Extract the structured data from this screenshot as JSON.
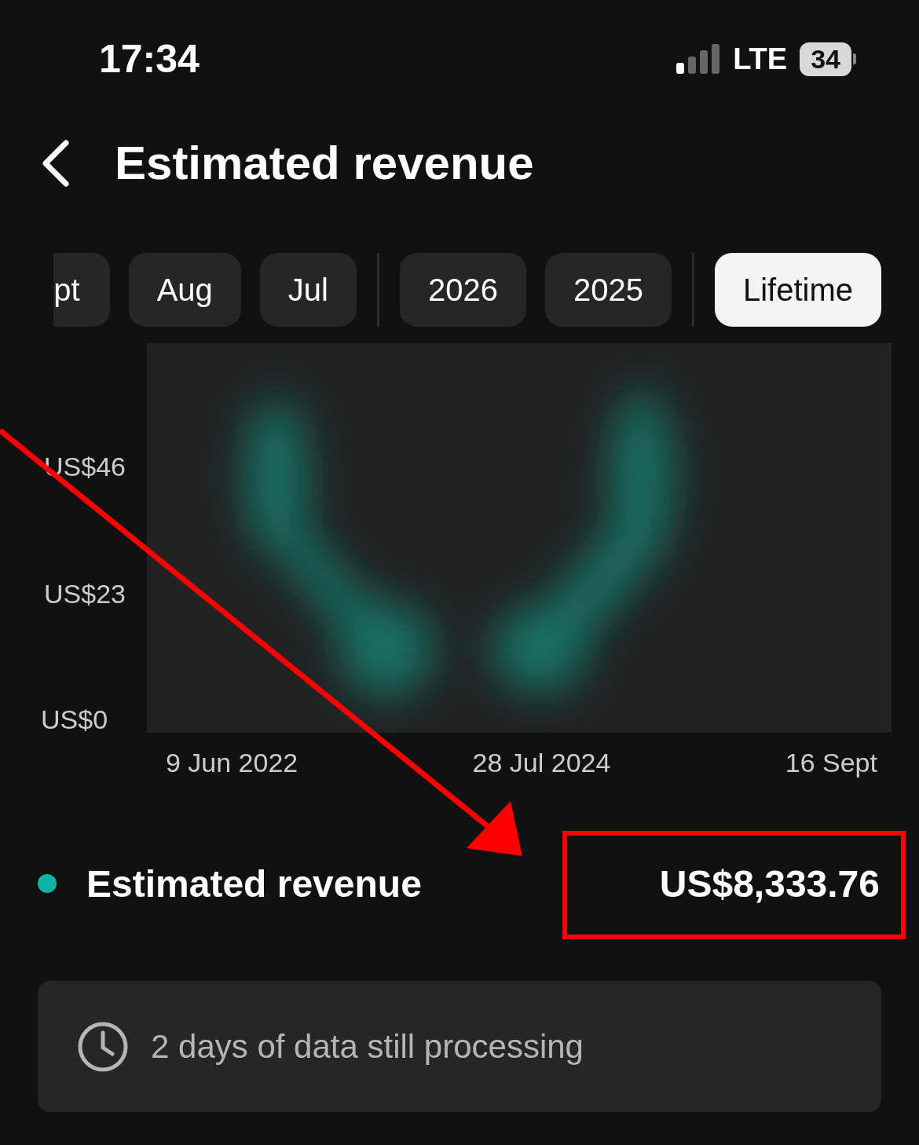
{
  "status_bar": {
    "time": "17:34",
    "network": "LTE",
    "battery": "34"
  },
  "header": {
    "title": "Estimated revenue"
  },
  "tab_groups": [
    {
      "tabs": [
        {
          "label": "pt",
          "selected": false
        },
        {
          "label": "Aug",
          "selected": false
        },
        {
          "label": "Jul",
          "selected": false
        }
      ]
    },
    {
      "tabs": [
        {
          "label": "2026",
          "selected": false
        },
        {
          "label": "2025",
          "selected": false
        }
      ]
    },
    {
      "tabs": [
        {
          "label": "Lifetime",
          "selected": true
        }
      ]
    }
  ],
  "chart": {
    "y_labels": [
      "US$46",
      "US$23",
      "US$0"
    ],
    "x_labels": [
      "9 Jun 2022",
      "28 Jul 2024",
      "16 Sept"
    ]
  },
  "legend": {
    "label": "Estimated revenue",
    "color": "#10b3a3",
    "value": "US$8,333.76"
  },
  "notice": {
    "text": "2 days of data still processing"
  }
}
